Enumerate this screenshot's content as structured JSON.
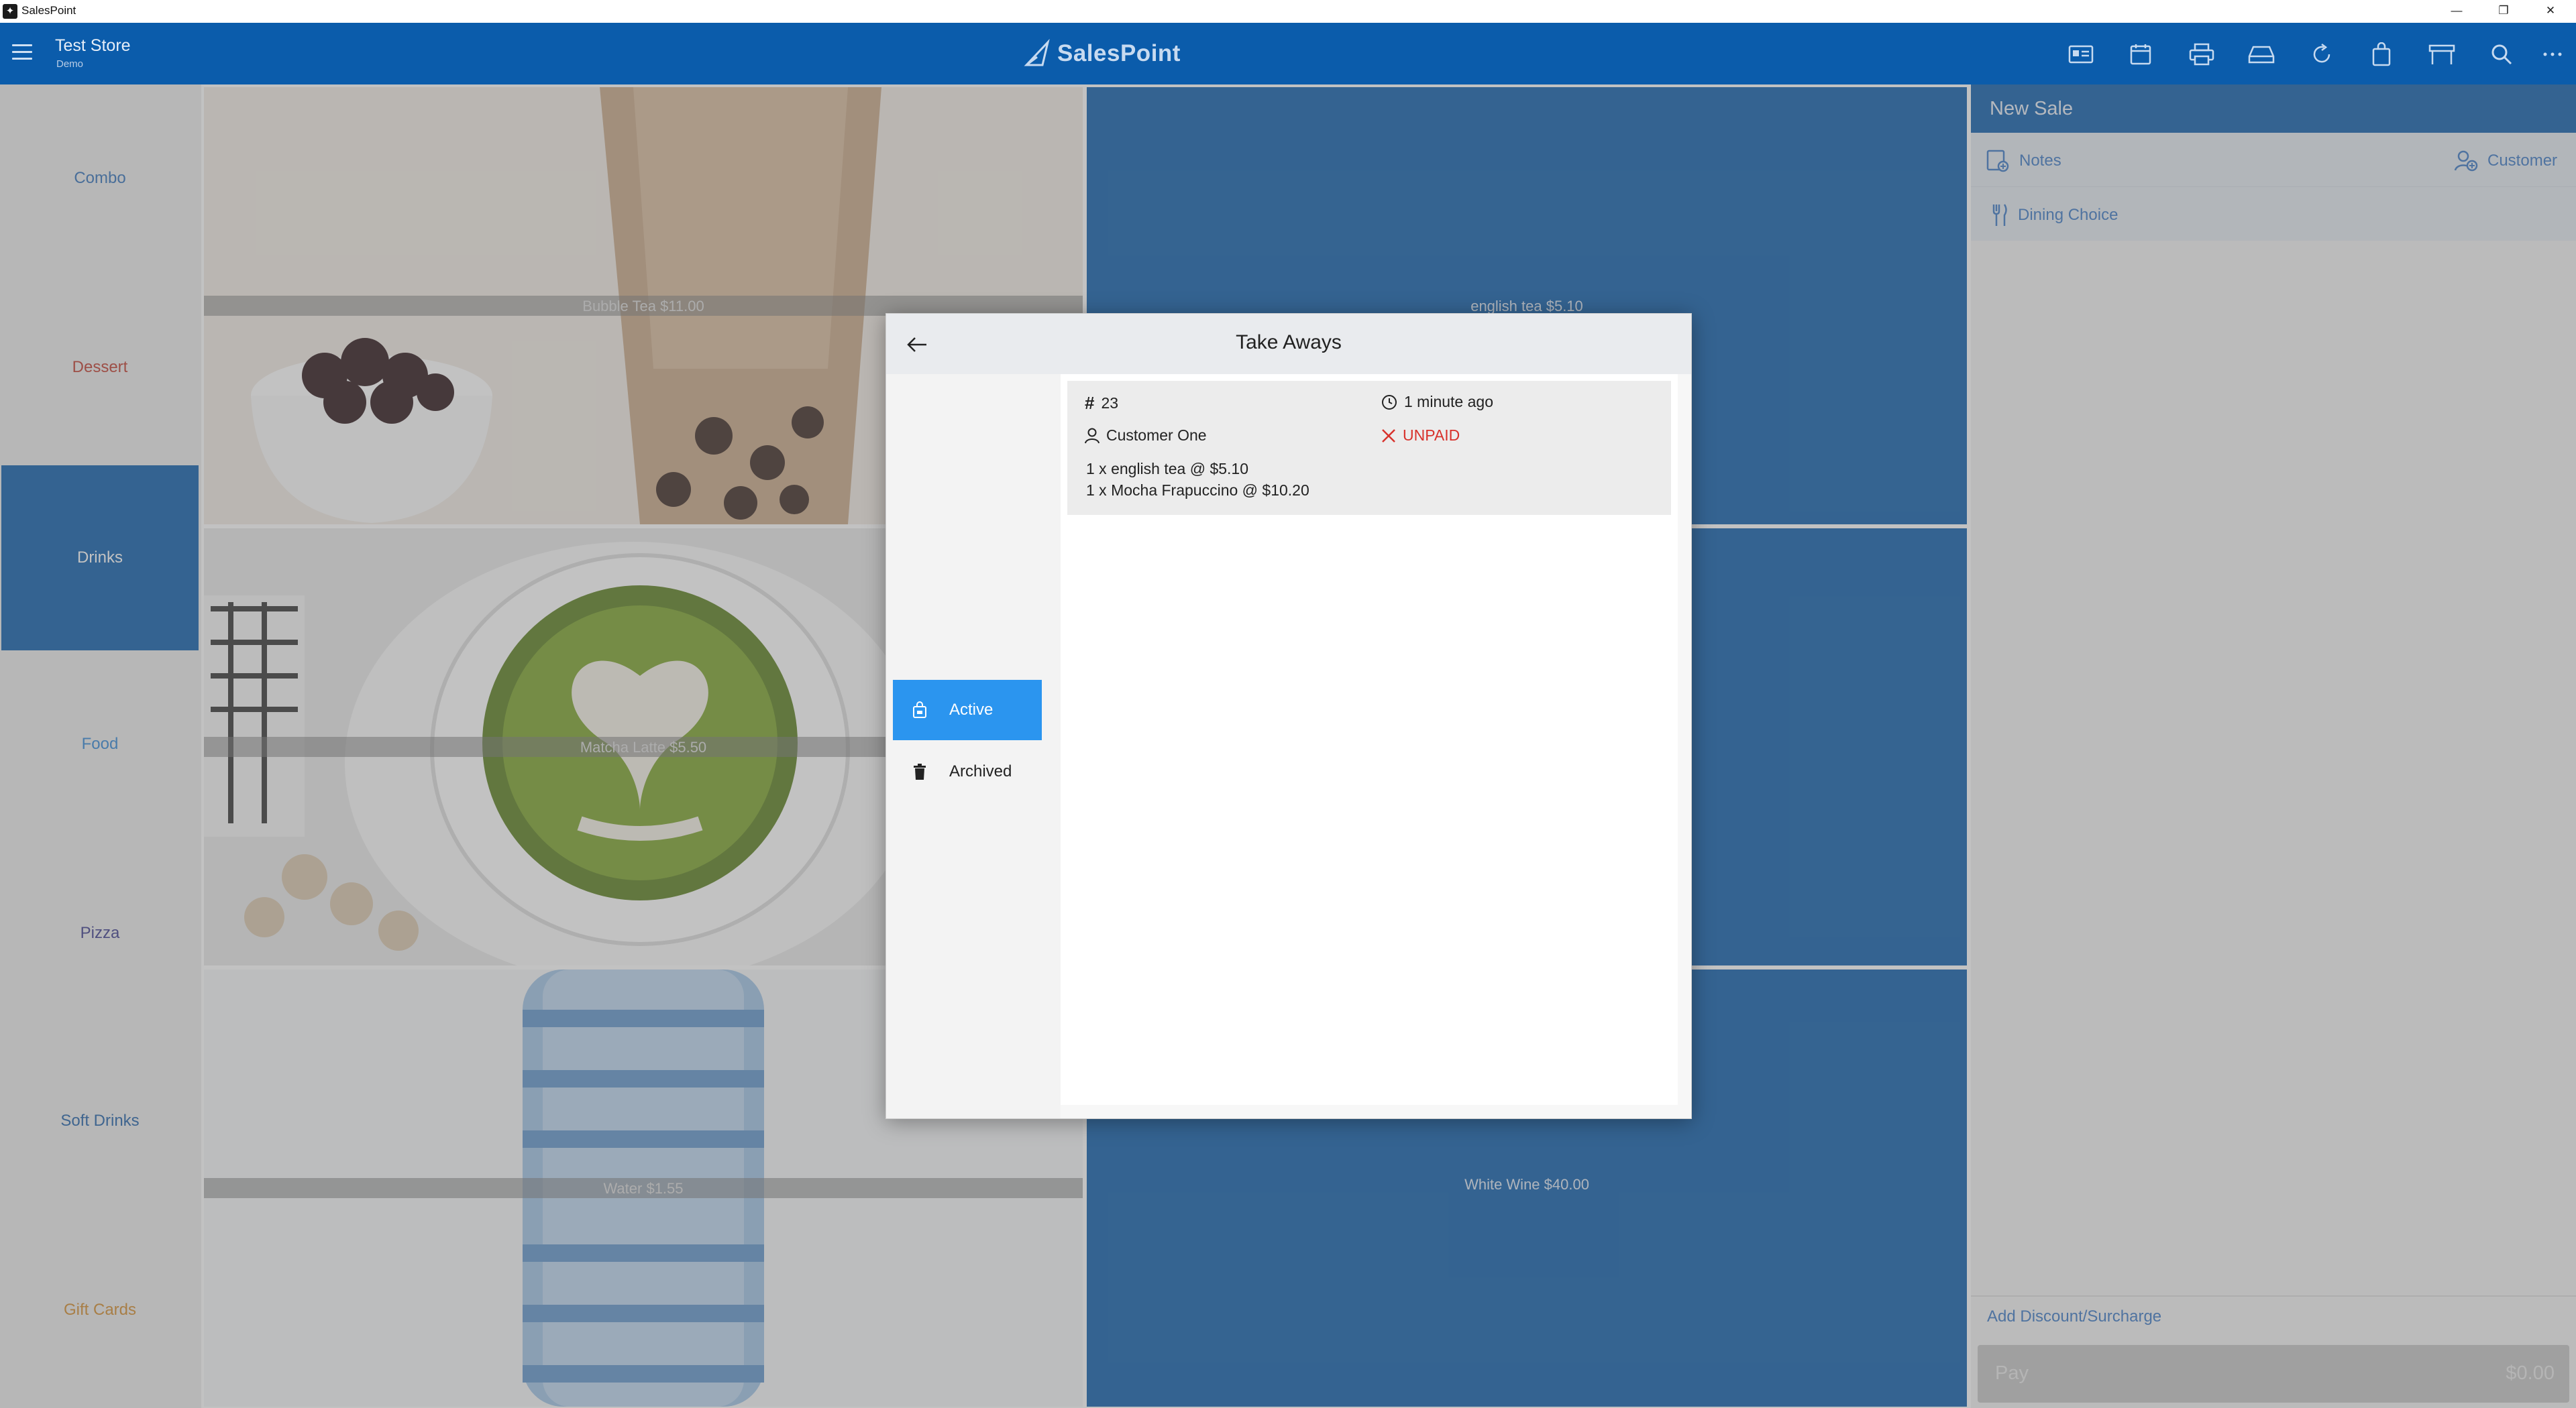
{
  "window": {
    "app_name": "SalesPoint",
    "controls": [
      "—",
      "❐",
      "✕"
    ]
  },
  "header": {
    "store_name": "Test Store",
    "store_sub": "Demo",
    "brand": "SalesPoint",
    "icons": [
      "id-card-icon",
      "calendar-icon",
      "printer-icon",
      "drawer-icon",
      "refresh-icon",
      "bag-icon",
      "store-icon",
      "search-icon",
      "more-icon"
    ]
  },
  "categories": [
    {
      "label": "Combo",
      "color": "#2f6fb8"
    },
    {
      "label": "Dessert",
      "color": "#c0392b"
    },
    {
      "label": "Drinks",
      "color": "#ffffff"
    },
    {
      "label": "Food",
      "color": "#2f86d6"
    },
    {
      "label": "Pizza",
      "color": "#3a3a8c"
    },
    {
      "label": "Soft Drinks",
      "color": "#1e5fa8"
    },
    {
      "label": "Gift Cards",
      "color": "#d38a2a"
    }
  ],
  "products": [
    {
      "label": "Bubble Tea $11.00"
    },
    {
      "label": "english tea $5.10"
    },
    {
      "label": "Matcha Latte $5.50"
    },
    {
      "label": ""
    },
    {
      "label": "Water $1.55"
    },
    {
      "label": "White Wine $40.00"
    }
  ],
  "sale": {
    "title": "New Sale",
    "notes": "Notes",
    "customer": "Customer",
    "dining_choice": "Dining Choice",
    "add_discount": "Add Discount/Surcharge",
    "pay_label": "Pay",
    "pay_amount": "$0.00"
  },
  "modal": {
    "title": "Take Aways",
    "nav": [
      {
        "label": "Active",
        "icon": "bag-icon"
      },
      {
        "label": "Archived",
        "icon": "trash-icon"
      }
    ],
    "order": {
      "number": "23",
      "time": "1 minute ago",
      "customer": "Customer One",
      "status": "UNPAID",
      "lines": [
        "1 x english tea @ $5.10",
        "1 x Mocha Frapuccino @ $10.20"
      ]
    }
  },
  "colors": {
    "header_blue": "#0b5cab",
    "accent_blue": "#2b95ef",
    "unpaid_red": "#d8322c"
  }
}
